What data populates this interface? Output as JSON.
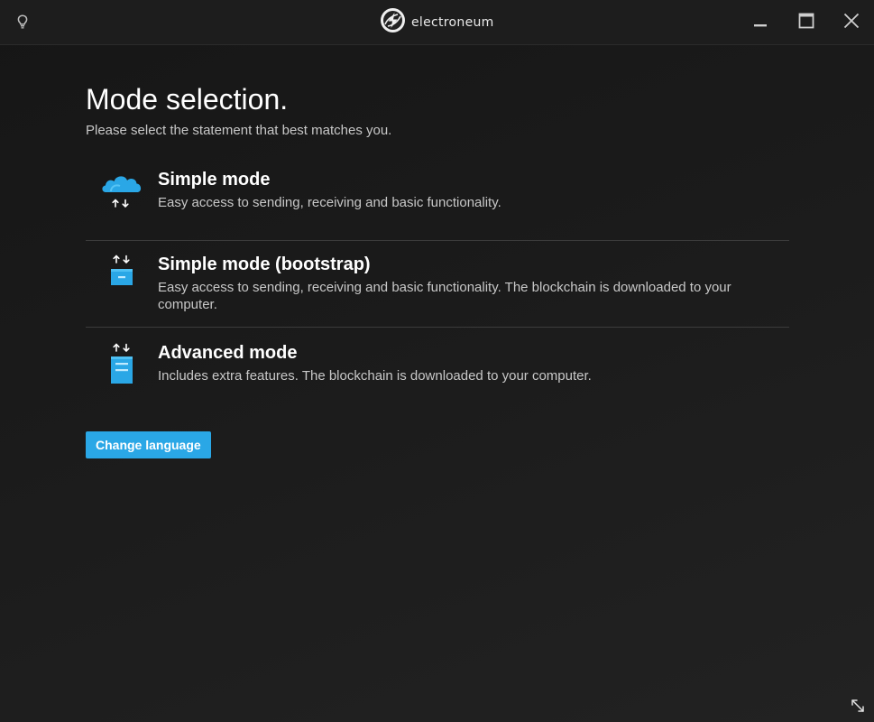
{
  "titlebar": {
    "app_name": "electroneum",
    "icons": {
      "theme": "lightbulb-icon",
      "logo": "electroneum-logo-icon",
      "minimize": "minimize-icon",
      "maximize": "maximize-icon",
      "close": "close-icon"
    }
  },
  "page": {
    "title": "Mode selection.",
    "subtitle": "Please select the statement that best matches you."
  },
  "modes": [
    {
      "title": "Simple mode",
      "description": "Easy access to sending, receiving and basic functionality.",
      "icon": "cloud-transfer-icon"
    },
    {
      "title": "Simple mode (bootstrap)",
      "description": "Easy access to sending, receiving and basic functionality. The blockchain is downloaded to your computer.",
      "icon": "transfer-small-server-icon"
    },
    {
      "title": "Advanced mode",
      "description": "Includes extra features. The blockchain is downloaded to your computer.",
      "icon": "transfer-server-icon"
    }
  ],
  "actions": {
    "change_language": "Change language"
  },
  "colors": {
    "accent": "#2aa7e6",
    "background": "#1b1b1b",
    "titlebar": "#1d1d1d",
    "text_primary": "#ffffff",
    "text_secondary": "#c8c8c8",
    "divider": "#3c3c3c"
  }
}
